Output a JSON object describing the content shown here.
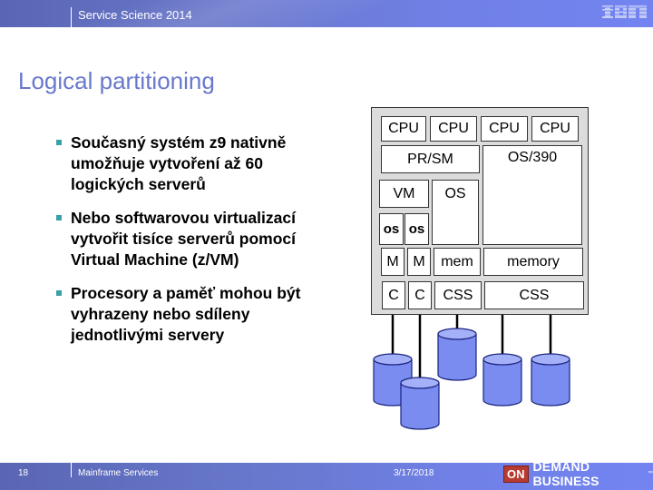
{
  "header": {
    "title": "Service Science 2014",
    "logo": "IBM"
  },
  "slide": {
    "title": "Logical partitioning"
  },
  "bullets": [
    {
      "line1": "Současný systém z9 nativně",
      "line2": "umožňuje vytvoření až 60",
      "line3": "logických serverů"
    },
    {
      "line1": "Nebo softwarovou virtualizací",
      "line2": "vytvořit tisíce serverů pomocí",
      "line3": "Virtual Machine (z/VM)"
    },
    {
      "line1": "Procesory a paměť mohou být",
      "line2": "vyhrazeny nebo sdíleny",
      "line3": "jednotlivými servery"
    }
  ],
  "diagram": {
    "cpus": [
      "CPU",
      "CPU",
      "CPU",
      "CPU"
    ],
    "prsm": "PR/SM",
    "os390": "OS/390",
    "vm": "VM",
    "os": "OS",
    "os_small": [
      "os",
      "os"
    ],
    "m": [
      "M",
      "M"
    ],
    "mem": "mem",
    "memory": "memory",
    "c": [
      "C",
      "C"
    ],
    "css": [
      "CSS",
      "CSS"
    ],
    "disk_count": 5,
    "colors": {
      "disk_fill": "#7a8cf0",
      "disk_top": "#a4b0f8",
      "panel": "#dcdcdc"
    }
  },
  "footer": {
    "page_number": "18",
    "text": "Mainframe Services",
    "date": "3/17/2018",
    "brand_on": "ON",
    "brand_text": "DEMAND BUSINESS",
    "brand_tm": "™"
  }
}
